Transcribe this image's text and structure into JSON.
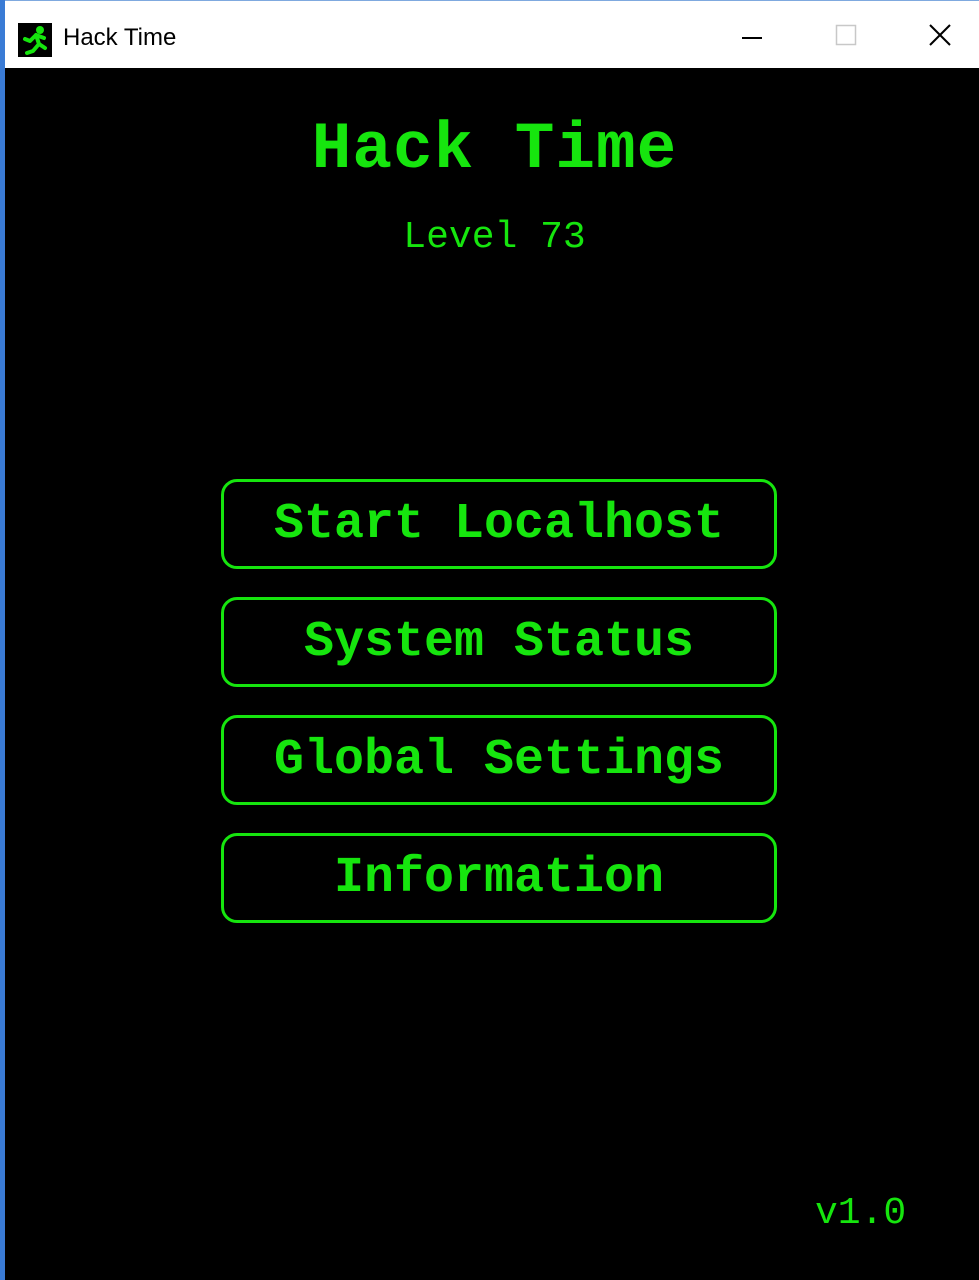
{
  "window": {
    "title": "Hack Time",
    "icon": "running-man-exit-icon",
    "controls": [
      "minimize-icon",
      "maximize-icon",
      "close-icon"
    ]
  },
  "app": {
    "title": "Hack Time",
    "level": "Level 73",
    "version": "v1.0"
  },
  "menu": {
    "start": "Start Localhost",
    "status": "System Status",
    "settings": "Global Settings",
    "info": "Information"
  },
  "colors": {
    "accent": "#16e50e",
    "background": "#000000",
    "titlebar": "#ffffff"
  }
}
